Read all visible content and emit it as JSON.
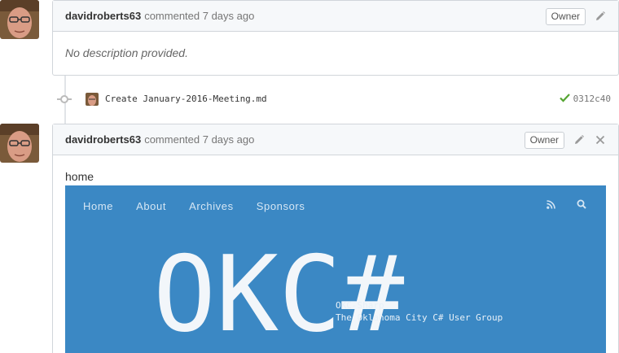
{
  "comments": [
    {
      "author": "davidroberts63",
      "meta": "commented 7 days ago",
      "badge": "Owner",
      "body_text": "No description provided."
    },
    {
      "author": "davidroberts63",
      "meta": "commented 7 days ago",
      "badge": "Owner",
      "body_text": "home"
    }
  ],
  "commit": {
    "message": "Create January-2016-Meeting.md",
    "sha": "0312c40",
    "status": "success"
  },
  "screenshot": {
    "nav": [
      "Home",
      "About",
      "Archives",
      "Sponsors"
    ],
    "logo_text": "OKC#",
    "tagline_1": "OKC-Sharp",
    "tagline_2": "The Oklahoma City C# User Group",
    "bg_color": "#3b88c4"
  },
  "icons": [
    "pencil-icon",
    "close-icon",
    "check-icon",
    "rss-icon",
    "search-icon",
    "commit-icon"
  ]
}
